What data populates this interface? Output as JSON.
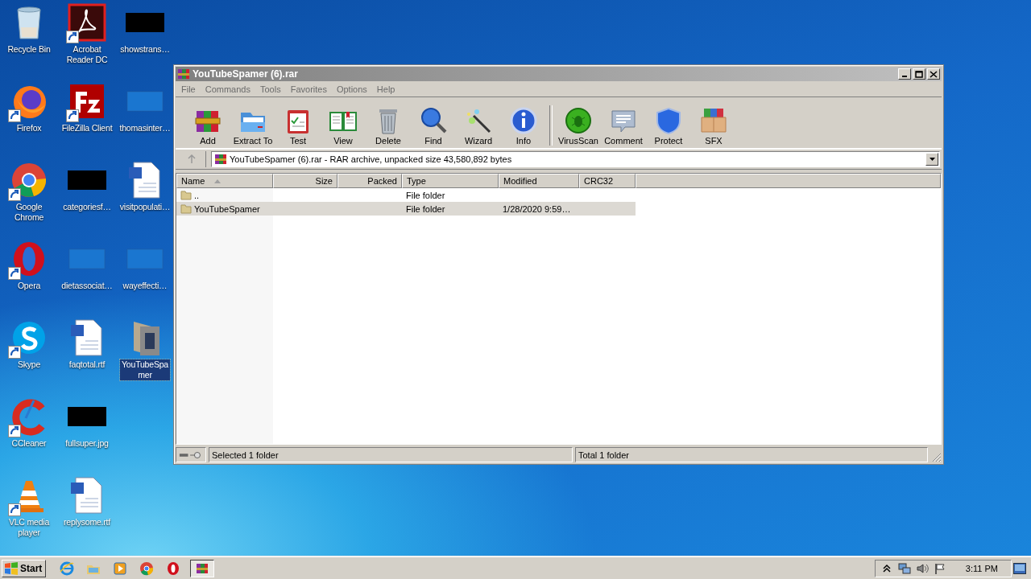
{
  "desktop": {
    "icons": [
      {
        "label": "Recycle Bin",
        "kind": "recycle",
        "shortcut": false,
        "selected": false
      },
      {
        "label": "Firefox",
        "kind": "firefox",
        "shortcut": true,
        "selected": false
      },
      {
        "label": "Google Chrome",
        "kind": "chrome",
        "shortcut": true,
        "selected": false
      },
      {
        "label": "Opera",
        "kind": "opera",
        "shortcut": true,
        "selected": false
      },
      {
        "label": "Skype",
        "kind": "skype",
        "shortcut": true,
        "selected": false
      },
      {
        "label": "CCleaner",
        "kind": "ccleaner",
        "shortcut": true,
        "selected": false
      },
      {
        "label": "VLC media player",
        "kind": "vlc",
        "shortcut": true,
        "selected": false
      },
      {
        "label": "Acrobat Reader DC",
        "kind": "acrobat",
        "shortcut": true,
        "selected": false
      },
      {
        "label": "FileZilla Client",
        "kind": "filezilla",
        "shortcut": true,
        "selected": false
      },
      {
        "label": "categoriesf…",
        "kind": "black",
        "shortcut": false,
        "selected": false
      },
      {
        "label": "dietassociat…",
        "kind": "blank",
        "shortcut": false,
        "selected": false
      },
      {
        "label": "faqtotal.rtf",
        "kind": "word",
        "shortcut": false,
        "selected": false
      },
      {
        "label": "fullsuper.jpg",
        "kind": "black",
        "shortcut": false,
        "selected": false
      },
      {
        "label": "replysome.rtf",
        "kind": "word",
        "shortcut": false,
        "selected": false
      },
      {
        "label": "showstrans…",
        "kind": "black",
        "shortcut": false,
        "selected": false
      },
      {
        "label": "thomasinter…",
        "kind": "blank",
        "shortcut": false,
        "selected": false
      },
      {
        "label": "visitpopulati…",
        "kind": "word",
        "shortcut": false,
        "selected": false
      },
      {
        "label": "wayeffecti…",
        "kind": "blank",
        "shortcut": false,
        "selected": false
      },
      {
        "label": "YouTubeSpamer",
        "kind": "archive",
        "shortcut": false,
        "selected": true
      }
    ]
  },
  "window": {
    "title": "YouTubeSpamer (6).rar",
    "menu": [
      "File",
      "Commands",
      "Tools",
      "Favorites",
      "Options",
      "Help"
    ],
    "toolbar": {
      "groups": [
        [
          {
            "label": "Add",
            "kind": "add"
          },
          {
            "label": "Extract To",
            "kind": "extract"
          },
          {
            "label": "Test",
            "kind": "test"
          },
          {
            "label": "View",
            "kind": "view"
          },
          {
            "label": "Delete",
            "kind": "delete"
          },
          {
            "label": "Find",
            "kind": "find"
          },
          {
            "label": "Wizard",
            "kind": "wizard"
          },
          {
            "label": "Info",
            "kind": "info"
          }
        ],
        [
          {
            "label": "VirusScan",
            "kind": "virus"
          },
          {
            "label": "Comment",
            "kind": "comment"
          },
          {
            "label": "Protect",
            "kind": "protect"
          },
          {
            "label": "SFX",
            "kind": "sfx"
          }
        ]
      ]
    },
    "address": "YouTubeSpamer (6).rar - RAR archive, unpacked size 43,580,892 bytes",
    "list": {
      "columns": [
        {
          "label": "Name",
          "sorted": true
        },
        {
          "label": "Size",
          "sorted": false
        },
        {
          "label": "Packed",
          "sorted": false
        },
        {
          "label": "Type",
          "sorted": false
        },
        {
          "label": "Modified",
          "sorted": false
        },
        {
          "label": "CRC32",
          "sorted": false
        }
      ],
      "rows": [
        {
          "cells": [
            "..",
            "",
            "",
            "File folder",
            "",
            ""
          ],
          "selected": false
        },
        {
          "cells": [
            "YouTubeSpamer",
            "",
            "",
            "File folder",
            "1/28/2020 9:59…",
            ""
          ],
          "selected": true
        }
      ]
    },
    "status_bar": {
      "left": "Selected 1 folder",
      "right": "Total 1 folder"
    }
  },
  "taskbar": {
    "start": "Start",
    "items": [
      {
        "kind": "ie",
        "active": false
      },
      {
        "kind": "explorer",
        "active": false
      },
      {
        "kind": "media",
        "active": false
      },
      {
        "kind": "chrome",
        "active": false
      },
      {
        "kind": "opera",
        "active": false
      },
      {
        "kind": "winrar",
        "active": true
      }
    ],
    "tray": [
      {
        "kind": "chevron"
      },
      {
        "kind": "network"
      },
      {
        "kind": "volume"
      },
      {
        "kind": "flag"
      }
    ],
    "clock": "3:11 PM"
  }
}
